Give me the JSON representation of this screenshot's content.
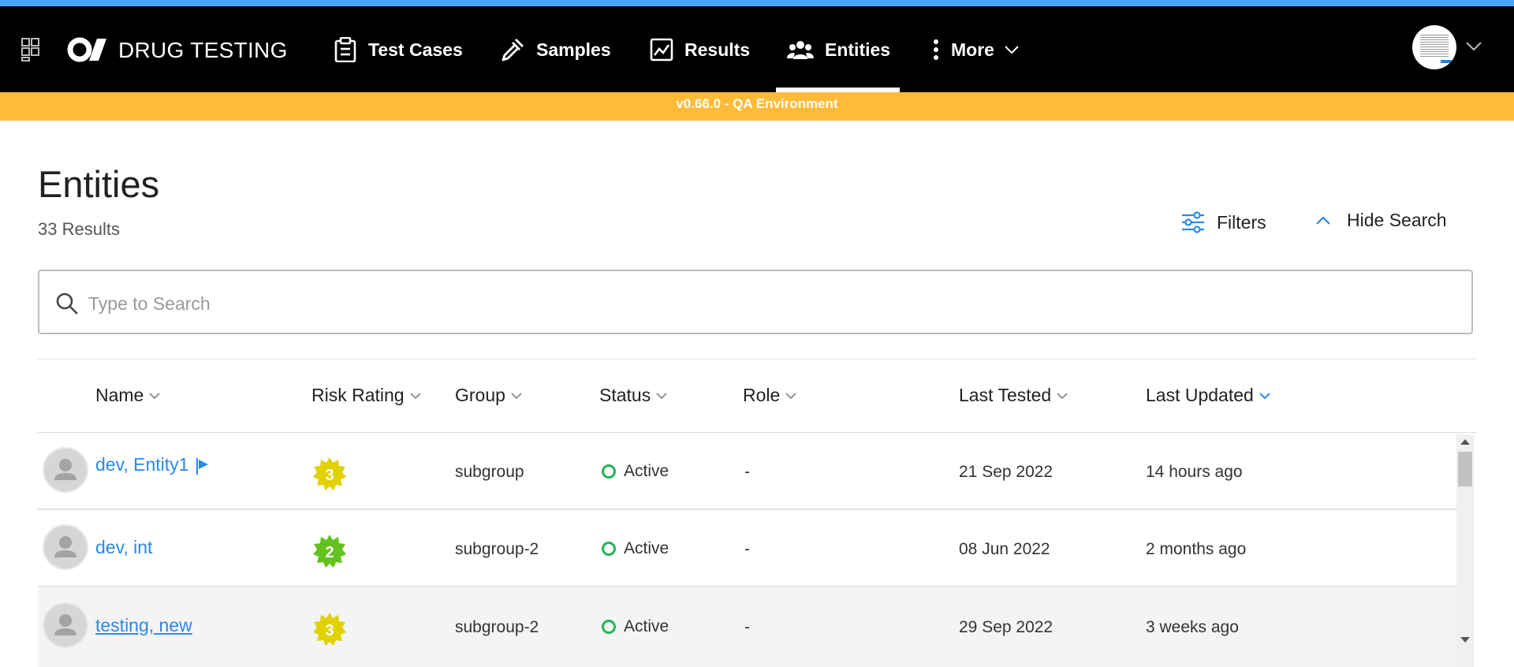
{
  "brand": {
    "name": "DRUG TESTING"
  },
  "nav": {
    "items": [
      {
        "label": "Test Cases",
        "icon": "clipboard-icon"
      },
      {
        "label": "Samples",
        "icon": "pipette-icon"
      },
      {
        "label": "Results",
        "icon": "chart-icon"
      },
      {
        "label": "Entities",
        "icon": "users-icon",
        "active": true
      },
      {
        "label": "More",
        "icon": "kebab-icon"
      }
    ]
  },
  "env": {
    "banner": "v0.66.0 - QA Environment"
  },
  "page": {
    "title": "Entities",
    "results": "33 Results",
    "filters_label": "Filters",
    "hide_search_label": "Hide Search"
  },
  "search": {
    "placeholder": "Type to Search",
    "value": ""
  },
  "table": {
    "columns": [
      "Name",
      "Risk Rating",
      "Group",
      "Status",
      "Role",
      "Last Tested",
      "Last Updated"
    ],
    "sorted_column": "Last Updated",
    "rows": [
      {
        "name": "dev, Entity1",
        "flag": true,
        "risk": "3",
        "risk_color": "#e2d100",
        "group": "subgroup",
        "status": "Active",
        "role": "-",
        "last_tested": "21 Sep 2022",
        "last_updated": "14 hours ago"
      },
      {
        "name": "dev, int",
        "flag": false,
        "risk": "2",
        "risk_color": "#63c21d",
        "group": "subgroup-2",
        "status": "Active",
        "role": "-",
        "last_tested": "08 Jun 2022",
        "last_updated": "2 months ago"
      },
      {
        "name": "testing, new",
        "flag": false,
        "risk": "3",
        "risk_color": "#e2d100",
        "group": "subgroup-2",
        "status": "Active",
        "role": "-",
        "last_tested": "29 Sep 2022",
        "last_updated": "3 weeks ago"
      }
    ]
  },
  "colors": {
    "nav_bg": "#000000",
    "env_bar": "#ffbb38",
    "link": "#2a8ae8",
    "accent": "#4da3f5",
    "status_active": "#24b35a"
  }
}
